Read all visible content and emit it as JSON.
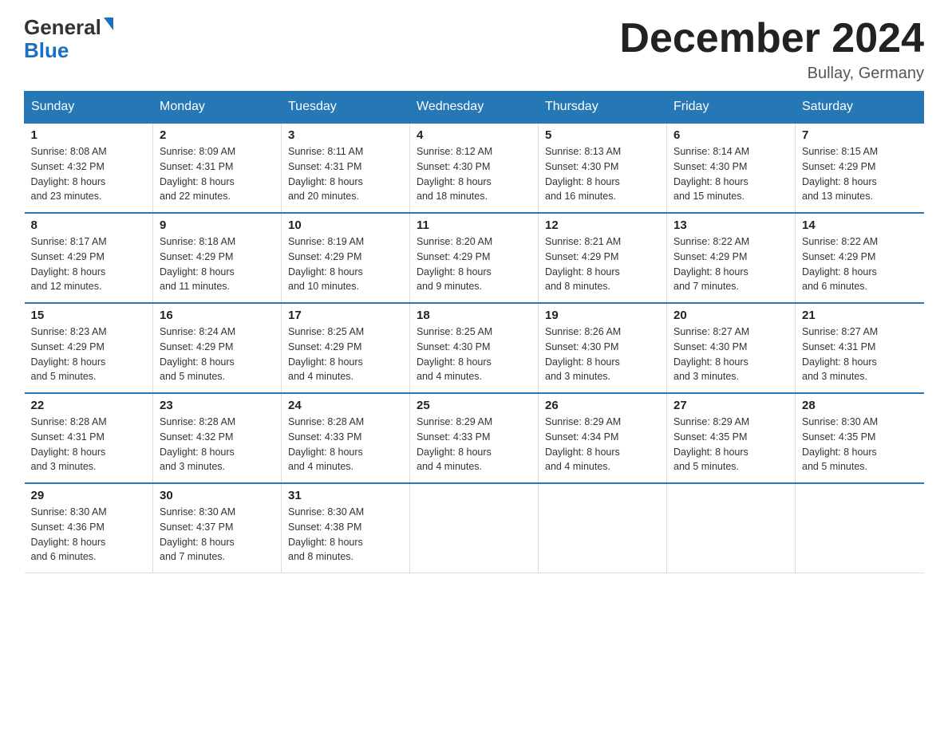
{
  "header": {
    "logo_general": "General",
    "logo_blue": "Blue",
    "month_title": "December 2024",
    "location": "Bullay, Germany"
  },
  "weekdays": [
    "Sunday",
    "Monday",
    "Tuesday",
    "Wednesday",
    "Thursday",
    "Friday",
    "Saturday"
  ],
  "weeks": [
    [
      {
        "day": "1",
        "sunrise": "8:08 AM",
        "sunset": "4:32 PM",
        "daylight": "8 hours and 23 minutes."
      },
      {
        "day": "2",
        "sunrise": "8:09 AM",
        "sunset": "4:31 PM",
        "daylight": "8 hours and 22 minutes."
      },
      {
        "day": "3",
        "sunrise": "8:11 AM",
        "sunset": "4:31 PM",
        "daylight": "8 hours and 20 minutes."
      },
      {
        "day": "4",
        "sunrise": "8:12 AM",
        "sunset": "4:30 PM",
        "daylight": "8 hours and 18 minutes."
      },
      {
        "day": "5",
        "sunrise": "8:13 AM",
        "sunset": "4:30 PM",
        "daylight": "8 hours and 16 minutes."
      },
      {
        "day": "6",
        "sunrise": "8:14 AM",
        "sunset": "4:30 PM",
        "daylight": "8 hours and 15 minutes."
      },
      {
        "day": "7",
        "sunrise": "8:15 AM",
        "sunset": "4:29 PM",
        "daylight": "8 hours and 13 minutes."
      }
    ],
    [
      {
        "day": "8",
        "sunrise": "8:17 AM",
        "sunset": "4:29 PM",
        "daylight": "8 hours and 12 minutes."
      },
      {
        "day": "9",
        "sunrise": "8:18 AM",
        "sunset": "4:29 PM",
        "daylight": "8 hours and 11 minutes."
      },
      {
        "day": "10",
        "sunrise": "8:19 AM",
        "sunset": "4:29 PM",
        "daylight": "8 hours and 10 minutes."
      },
      {
        "day": "11",
        "sunrise": "8:20 AM",
        "sunset": "4:29 PM",
        "daylight": "8 hours and 9 minutes."
      },
      {
        "day": "12",
        "sunrise": "8:21 AM",
        "sunset": "4:29 PM",
        "daylight": "8 hours and 8 minutes."
      },
      {
        "day": "13",
        "sunrise": "8:22 AM",
        "sunset": "4:29 PM",
        "daylight": "8 hours and 7 minutes."
      },
      {
        "day": "14",
        "sunrise": "8:22 AM",
        "sunset": "4:29 PM",
        "daylight": "8 hours and 6 minutes."
      }
    ],
    [
      {
        "day": "15",
        "sunrise": "8:23 AM",
        "sunset": "4:29 PM",
        "daylight": "8 hours and 5 minutes."
      },
      {
        "day": "16",
        "sunrise": "8:24 AM",
        "sunset": "4:29 PM",
        "daylight": "8 hours and 5 minutes."
      },
      {
        "day": "17",
        "sunrise": "8:25 AM",
        "sunset": "4:29 PM",
        "daylight": "8 hours and 4 minutes."
      },
      {
        "day": "18",
        "sunrise": "8:25 AM",
        "sunset": "4:30 PM",
        "daylight": "8 hours and 4 minutes."
      },
      {
        "day": "19",
        "sunrise": "8:26 AM",
        "sunset": "4:30 PM",
        "daylight": "8 hours and 3 minutes."
      },
      {
        "day": "20",
        "sunrise": "8:27 AM",
        "sunset": "4:30 PM",
        "daylight": "8 hours and 3 minutes."
      },
      {
        "day": "21",
        "sunrise": "8:27 AM",
        "sunset": "4:31 PM",
        "daylight": "8 hours and 3 minutes."
      }
    ],
    [
      {
        "day": "22",
        "sunrise": "8:28 AM",
        "sunset": "4:31 PM",
        "daylight": "8 hours and 3 minutes."
      },
      {
        "day": "23",
        "sunrise": "8:28 AM",
        "sunset": "4:32 PM",
        "daylight": "8 hours and 3 minutes."
      },
      {
        "day": "24",
        "sunrise": "8:28 AM",
        "sunset": "4:33 PM",
        "daylight": "8 hours and 4 minutes."
      },
      {
        "day": "25",
        "sunrise": "8:29 AM",
        "sunset": "4:33 PM",
        "daylight": "8 hours and 4 minutes."
      },
      {
        "day": "26",
        "sunrise": "8:29 AM",
        "sunset": "4:34 PM",
        "daylight": "8 hours and 4 minutes."
      },
      {
        "day": "27",
        "sunrise": "8:29 AM",
        "sunset": "4:35 PM",
        "daylight": "8 hours and 5 minutes."
      },
      {
        "day": "28",
        "sunrise": "8:30 AM",
        "sunset": "4:35 PM",
        "daylight": "8 hours and 5 minutes."
      }
    ],
    [
      {
        "day": "29",
        "sunrise": "8:30 AM",
        "sunset": "4:36 PM",
        "daylight": "8 hours and 6 minutes."
      },
      {
        "day": "30",
        "sunrise": "8:30 AM",
        "sunset": "4:37 PM",
        "daylight": "8 hours and 7 minutes."
      },
      {
        "day": "31",
        "sunrise": "8:30 AM",
        "sunset": "4:38 PM",
        "daylight": "8 hours and 8 minutes."
      },
      null,
      null,
      null,
      null
    ]
  ],
  "labels": {
    "sunrise": "Sunrise:",
    "sunset": "Sunset:",
    "daylight": "Daylight:"
  }
}
